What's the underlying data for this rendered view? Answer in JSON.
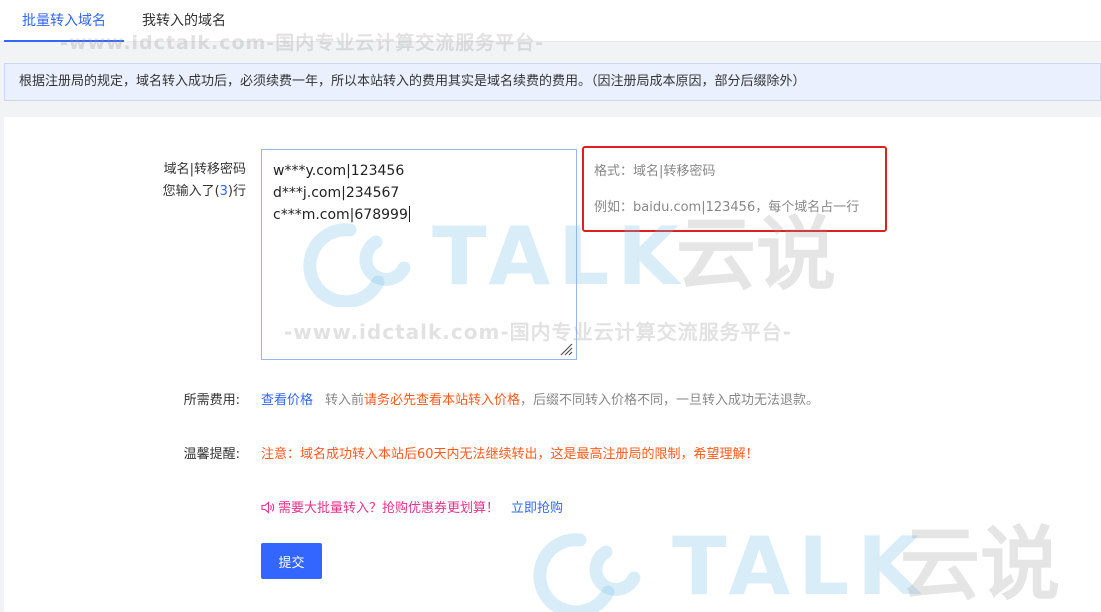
{
  "tabs": [
    {
      "label": "批量转入域名",
      "active": true
    },
    {
      "label": "我转入的域名",
      "active": false
    }
  ],
  "notice": "根据注册局的规定，域名转入成功后，必须续费一年，所以本站转入的费用其实是域名续费的费用。（因注册局成本原因，部分后缀除外）",
  "form": {
    "domain_label": "域名|转移密码",
    "count_prefix": "您输入了(",
    "count_value": "3",
    "count_suffix": ")行",
    "lines": [
      "w***y.com|123456",
      "d***j.com|234567",
      "c***m.com|678999"
    ],
    "hint_format": "格式：域名|转移密码",
    "hint_example": "例如：baidu.com|123456，每个域名占一行"
  },
  "fee": {
    "label": "所需费用:",
    "link": "查看价格",
    "text_before": "转入前",
    "text_highlight": "请务必先查看本站转入价格",
    "text_after": "，后缀不同转入价格不同，一旦转入成功无法退款。"
  },
  "tip": {
    "label": "温馨提醒:",
    "text": "注意：域名成功转入本站后60天内无法继续转出，这是最高注册局的限制，希望理解！"
  },
  "promo": {
    "text": "需要大批量转入？抢购优惠券更划算！",
    "link": "立即抢购"
  },
  "submit_label": "提交",
  "watermark": {
    "brand": "TALK",
    "brand_cn": "云说",
    "tagline": "-www.idctalk.com-国内专业云计算交流服务平台-"
  },
  "colors": {
    "accent": "#3366ff",
    "warning": "#ff5a1f",
    "promo": "#e8338a",
    "highlight_border": "#e02020"
  }
}
